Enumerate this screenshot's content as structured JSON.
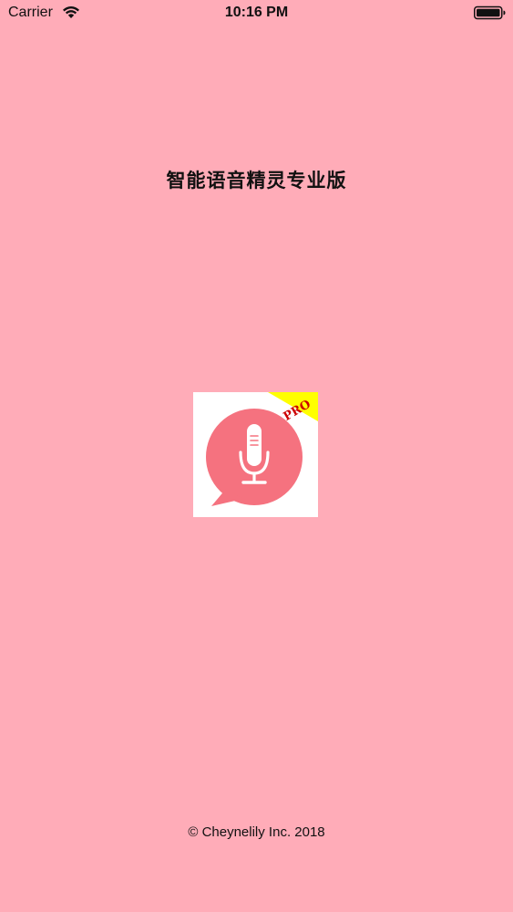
{
  "status_bar": {
    "carrier": "Carrier",
    "time": "10:16 PM",
    "wifi_icon": "wifi-icon",
    "battery_icon": "battery-icon"
  },
  "launch": {
    "title": "智能语音精灵专业版",
    "icon": {
      "name": "microphone-speech-bubble-icon",
      "badge": "PRO",
      "bubble_color": "#f5727f",
      "badge_color": "#ffff00",
      "badge_text_color": "#cc0000",
      "background_color": "#ffffff"
    },
    "copyright": "© Cheynelily Inc. 2018"
  },
  "colors": {
    "background": "#ffacb8",
    "text": "#111111"
  }
}
